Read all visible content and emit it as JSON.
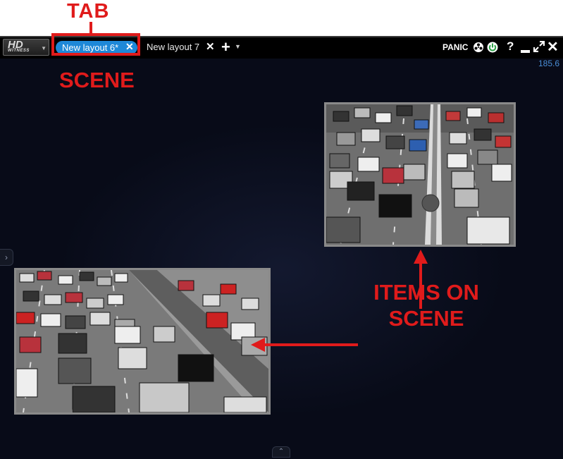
{
  "annotations": {
    "tab_label": "TAB",
    "scene_label": "SCENE",
    "items_label_line1": "ITEMS ON",
    "items_label_line2": "SCENE",
    "color": "#e01b1b"
  },
  "toolbar": {
    "logo_main": "HD",
    "logo_sub": "WITNESS",
    "tabs": [
      {
        "label": "New layout 6*",
        "active": true
      },
      {
        "label": "New layout 7",
        "active": false
      }
    ],
    "close_glyph": "✕",
    "add_glyph": "+",
    "panic_label": "PANIC",
    "help_glyph": "?",
    "close_window_glyph": "✕",
    "accent_color": "#1e88d8"
  },
  "scene": {
    "fps_value": "185.6",
    "side_handle_glyph": "›",
    "bottom_handle_glyph": "⌃",
    "items": [
      {
        "name": "camera-feed-highway-1",
        "content": "traffic"
      },
      {
        "name": "camera-feed-highway-2",
        "content": "traffic"
      }
    ]
  },
  "icons": [
    "hd-witness-logo-icon",
    "tab-close-icon",
    "add-tab-icon",
    "film-reel-icon",
    "power-icon",
    "help-icon",
    "minimize-icon",
    "maximize-icon",
    "close-window-icon",
    "arrow-icon"
  ]
}
